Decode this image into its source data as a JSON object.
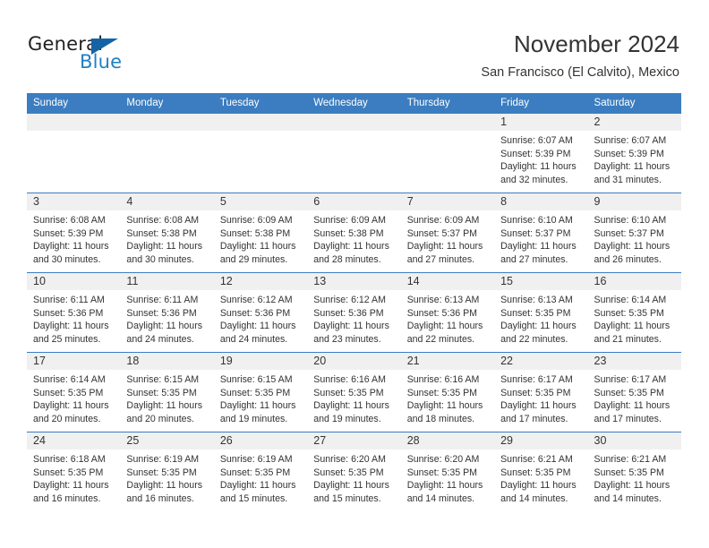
{
  "brand": {
    "name_part1": "General",
    "name_part2": "Blue",
    "accent_color": "#1464a5",
    "blue_text_color": "#1f7fc4"
  },
  "header": {
    "title": "November 2024",
    "subtitle": "San Francisco (El Calvito), Mexico"
  },
  "calendar": {
    "header_color": "#3b7dc0",
    "daynum_band_color": "#f0f0f0",
    "weekdays": [
      "Sunday",
      "Monday",
      "Tuesday",
      "Wednesday",
      "Thursday",
      "Friday",
      "Saturday"
    ],
    "weeks": [
      [
        {
          "day": "",
          "lines": []
        },
        {
          "day": "",
          "lines": []
        },
        {
          "day": "",
          "lines": []
        },
        {
          "day": "",
          "lines": []
        },
        {
          "day": "",
          "lines": []
        },
        {
          "day": "1",
          "lines": [
            "Sunrise: 6:07 AM",
            "Sunset: 5:39 PM",
            "Daylight: 11 hours",
            "and 32 minutes."
          ]
        },
        {
          "day": "2",
          "lines": [
            "Sunrise: 6:07 AM",
            "Sunset: 5:39 PM",
            "Daylight: 11 hours",
            "and 31 minutes."
          ]
        }
      ],
      [
        {
          "day": "3",
          "lines": [
            "Sunrise: 6:08 AM",
            "Sunset: 5:39 PM",
            "Daylight: 11 hours",
            "and 30 minutes."
          ]
        },
        {
          "day": "4",
          "lines": [
            "Sunrise: 6:08 AM",
            "Sunset: 5:38 PM",
            "Daylight: 11 hours",
            "and 30 minutes."
          ]
        },
        {
          "day": "5",
          "lines": [
            "Sunrise: 6:09 AM",
            "Sunset: 5:38 PM",
            "Daylight: 11 hours",
            "and 29 minutes."
          ]
        },
        {
          "day": "6",
          "lines": [
            "Sunrise: 6:09 AM",
            "Sunset: 5:38 PM",
            "Daylight: 11 hours",
            "and 28 minutes."
          ]
        },
        {
          "day": "7",
          "lines": [
            "Sunrise: 6:09 AM",
            "Sunset: 5:37 PM",
            "Daylight: 11 hours",
            "and 27 minutes."
          ]
        },
        {
          "day": "8",
          "lines": [
            "Sunrise: 6:10 AM",
            "Sunset: 5:37 PM",
            "Daylight: 11 hours",
            "and 27 minutes."
          ]
        },
        {
          "day": "9",
          "lines": [
            "Sunrise: 6:10 AM",
            "Sunset: 5:37 PM",
            "Daylight: 11 hours",
            "and 26 minutes."
          ]
        }
      ],
      [
        {
          "day": "10",
          "lines": [
            "Sunrise: 6:11 AM",
            "Sunset: 5:36 PM",
            "Daylight: 11 hours",
            "and 25 minutes."
          ]
        },
        {
          "day": "11",
          "lines": [
            "Sunrise: 6:11 AM",
            "Sunset: 5:36 PM",
            "Daylight: 11 hours",
            "and 24 minutes."
          ]
        },
        {
          "day": "12",
          "lines": [
            "Sunrise: 6:12 AM",
            "Sunset: 5:36 PM",
            "Daylight: 11 hours",
            "and 24 minutes."
          ]
        },
        {
          "day": "13",
          "lines": [
            "Sunrise: 6:12 AM",
            "Sunset: 5:36 PM",
            "Daylight: 11 hours",
            "and 23 minutes."
          ]
        },
        {
          "day": "14",
          "lines": [
            "Sunrise: 6:13 AM",
            "Sunset: 5:36 PM",
            "Daylight: 11 hours",
            "and 22 minutes."
          ]
        },
        {
          "day": "15",
          "lines": [
            "Sunrise: 6:13 AM",
            "Sunset: 5:35 PM",
            "Daylight: 11 hours",
            "and 22 minutes."
          ]
        },
        {
          "day": "16",
          "lines": [
            "Sunrise: 6:14 AM",
            "Sunset: 5:35 PM",
            "Daylight: 11 hours",
            "and 21 minutes."
          ]
        }
      ],
      [
        {
          "day": "17",
          "lines": [
            "Sunrise: 6:14 AM",
            "Sunset: 5:35 PM",
            "Daylight: 11 hours",
            "and 20 minutes."
          ]
        },
        {
          "day": "18",
          "lines": [
            "Sunrise: 6:15 AM",
            "Sunset: 5:35 PM",
            "Daylight: 11 hours",
            "and 20 minutes."
          ]
        },
        {
          "day": "19",
          "lines": [
            "Sunrise: 6:15 AM",
            "Sunset: 5:35 PM",
            "Daylight: 11 hours",
            "and 19 minutes."
          ]
        },
        {
          "day": "20",
          "lines": [
            "Sunrise: 6:16 AM",
            "Sunset: 5:35 PM",
            "Daylight: 11 hours",
            "and 19 minutes."
          ]
        },
        {
          "day": "21",
          "lines": [
            "Sunrise: 6:16 AM",
            "Sunset: 5:35 PM",
            "Daylight: 11 hours",
            "and 18 minutes."
          ]
        },
        {
          "day": "22",
          "lines": [
            "Sunrise: 6:17 AM",
            "Sunset: 5:35 PM",
            "Daylight: 11 hours",
            "and 17 minutes."
          ]
        },
        {
          "day": "23",
          "lines": [
            "Sunrise: 6:17 AM",
            "Sunset: 5:35 PM",
            "Daylight: 11 hours",
            "and 17 minutes."
          ]
        }
      ],
      [
        {
          "day": "24",
          "lines": [
            "Sunrise: 6:18 AM",
            "Sunset: 5:35 PM",
            "Daylight: 11 hours",
            "and 16 minutes."
          ]
        },
        {
          "day": "25",
          "lines": [
            "Sunrise: 6:19 AM",
            "Sunset: 5:35 PM",
            "Daylight: 11 hours",
            "and 16 minutes."
          ]
        },
        {
          "day": "26",
          "lines": [
            "Sunrise: 6:19 AM",
            "Sunset: 5:35 PM",
            "Daylight: 11 hours",
            "and 15 minutes."
          ]
        },
        {
          "day": "27",
          "lines": [
            "Sunrise: 6:20 AM",
            "Sunset: 5:35 PM",
            "Daylight: 11 hours",
            "and 15 minutes."
          ]
        },
        {
          "day": "28",
          "lines": [
            "Sunrise: 6:20 AM",
            "Sunset: 5:35 PM",
            "Daylight: 11 hours",
            "and 14 minutes."
          ]
        },
        {
          "day": "29",
          "lines": [
            "Sunrise: 6:21 AM",
            "Sunset: 5:35 PM",
            "Daylight: 11 hours",
            "and 14 minutes."
          ]
        },
        {
          "day": "30",
          "lines": [
            "Sunrise: 6:21 AM",
            "Sunset: 5:35 PM",
            "Daylight: 11 hours",
            "and 14 minutes."
          ]
        }
      ]
    ]
  }
}
